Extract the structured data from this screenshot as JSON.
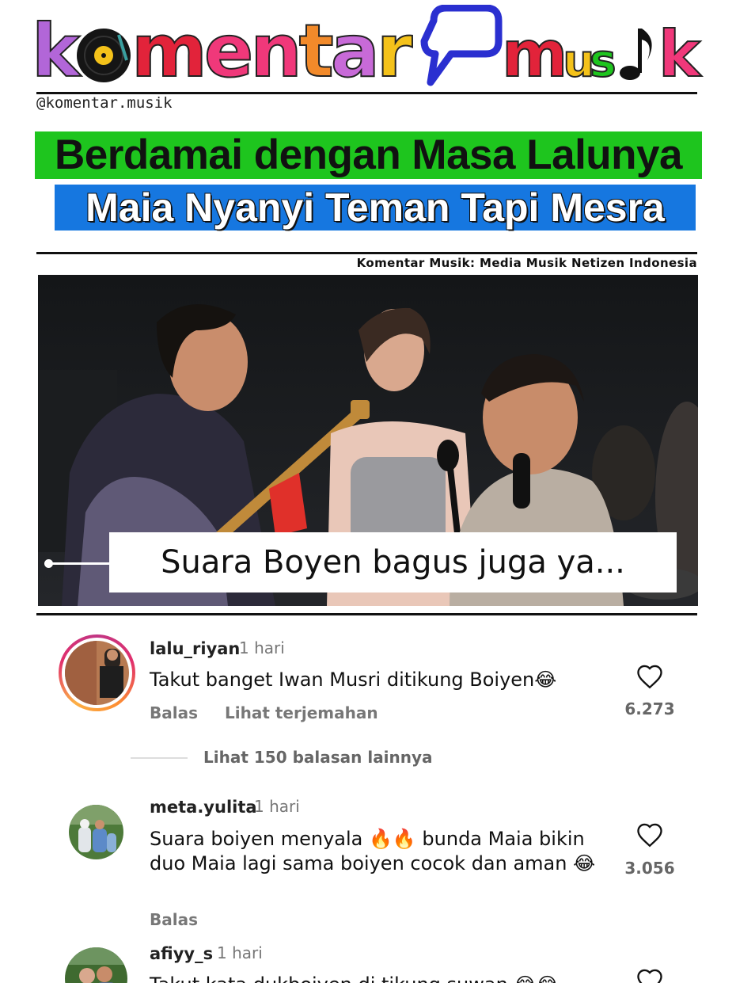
{
  "brand": {
    "logo_text": "komentar musik",
    "handle": "@komentar.musik",
    "tagline": "Komentar Musik: Media Musik Netizen Indonesia"
  },
  "headline": {
    "line1": "Berdamai dengan Masa Lalunya",
    "line2": "Maia Nyanyi Teman Tapi Mesra"
  },
  "video": {
    "caption": "Suara Boyen bagus juga ya..."
  },
  "comments": [
    {
      "user": "lalu_riyan",
      "time": "1 hari",
      "text": "Takut banget Iwan Musri ditikung Boiyen😂",
      "reply_label": "Balas",
      "translate_label": "Lihat terjemahan",
      "likes": "6.273"
    },
    {
      "user": "meta.yulita",
      "time": "1 hari",
      "text": "Suara boiyen menyala 🔥🔥 bunda Maia bikin duo Maia lagi sama boiyen cocok dan aman 😂",
      "reply_label": "Balas",
      "likes": "3.056"
    },
    {
      "user": "afiyy_s",
      "time": "1 hari",
      "text": "Takut kata dukboiyen di tikung suwan 😂😂"
    }
  ],
  "more_replies": "Lihat 150 balasan lainnya",
  "colors": {
    "headline_green": "#1ec51e",
    "headline_blue": "#1677e0",
    "story_ring_start": "#c13584",
    "story_ring_end": "#fcaf45"
  },
  "icons": [
    "vinyl-record-icon",
    "speech-bubble-icon",
    "music-note-icon",
    "heart-icon"
  ]
}
